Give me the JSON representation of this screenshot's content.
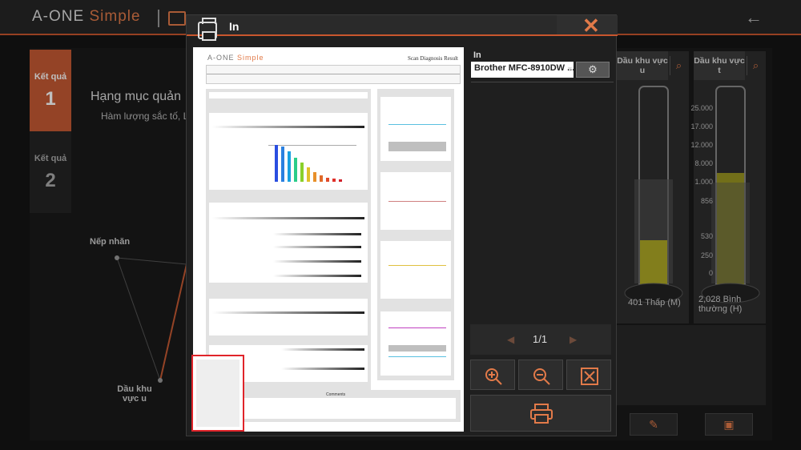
{
  "app": {
    "brand_main": "A-ONE",
    "brand_simple": "Simple"
  },
  "background": {
    "tab1_label": "Kết quả",
    "tab1_number": "1",
    "tab2_label": "Kết quả",
    "tab2_number": "2",
    "section_title": "Hạng mục quản",
    "section_subtitle": "Hàm lượng sắc tố, Lo",
    "radar_label_1": "Nếp nhăn",
    "radar_label_2": "Dầu khu vực u",
    "tube1_header": "Dầu khu vực u",
    "tube2_header": "Dầu khu vực t",
    "scale_labels": [
      "25.000",
      "17.000",
      "12.000",
      "8.000",
      "1.000",
      "856",
      "530",
      "250",
      "0"
    ],
    "tube1_value": "401",
    "tube1_status": "Thấp (M)",
    "tube2_value": "2,028",
    "tube2_status": "Bình thường (H)"
  },
  "dialog": {
    "title": "In",
    "close_glyph": "✕",
    "printer_label": "In",
    "printer_name": "Brother MFC-8910DW ...",
    "page_indicator": "1/1",
    "prev_glyph": "◀",
    "next_glyph": "▶"
  },
  "preview": {
    "logo_main": "A-ONE",
    "logo_simple": "Simple",
    "result_title": "Scan Diagnosis Result",
    "comments_title": "Comments"
  },
  "icons": {
    "close": "close-icon",
    "print": "printer-icon",
    "settings": "gear-icon",
    "zoom_in": "zoom-in-icon",
    "zoom_out": "zoom-out-icon",
    "fit": "fit-screen-icon",
    "search": "search-icon",
    "back": "back-arrow-icon"
  },
  "colors": {
    "accent": "#e27a49",
    "accent_dark": "#c65a33",
    "thumbnail_border": "#e0242a",
    "tube_fill": "#c8c21e"
  }
}
